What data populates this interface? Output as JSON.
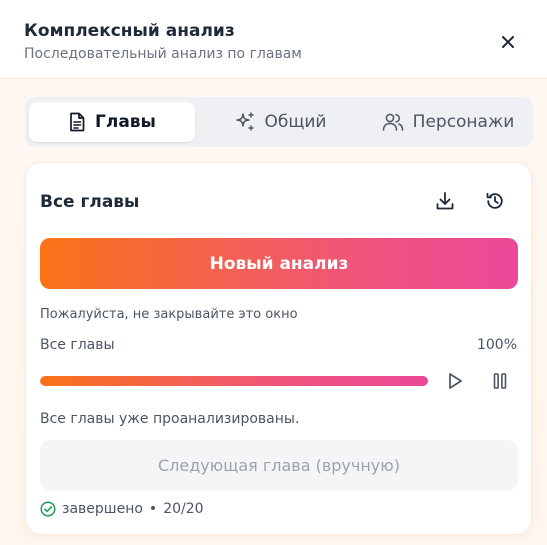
{
  "header": {
    "title": "Комплексный анализ",
    "subtitle": "Последовательный анализ по главам"
  },
  "tabs": [
    {
      "label": "Главы",
      "icon": "document-icon",
      "active": true
    },
    {
      "label": "Общий",
      "icon": "sparkles-icon",
      "active": false
    },
    {
      "label": "Персонажи",
      "icon": "users-icon",
      "active": false
    }
  ],
  "card": {
    "title": "Все главы",
    "primary_button": "Новый анализ",
    "warning": "Пожалуйста, не закрывайте это окно",
    "progress": {
      "label": "Все главы",
      "percent_text": "100%",
      "value": 1.0
    },
    "status_text": "Все главы уже проанализированы.",
    "next_button": "Следующая глава (вручную)",
    "done": {
      "status": "завершено",
      "separator": "•",
      "count": "20/20"
    }
  },
  "colors": {
    "accent_start": "#f97316",
    "accent_end": "#ec4899",
    "success": "#22a05a"
  }
}
